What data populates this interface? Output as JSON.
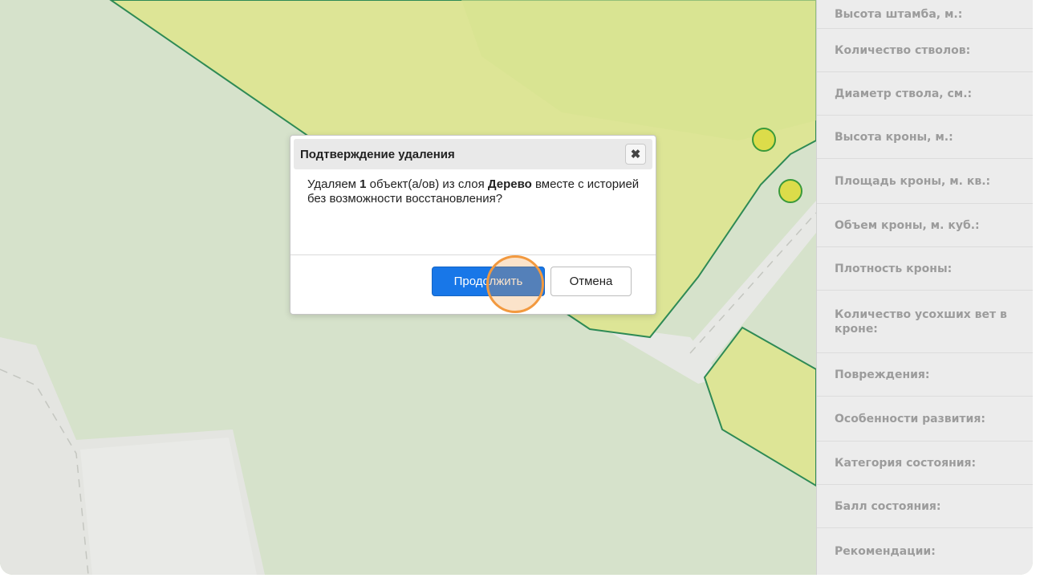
{
  "dialog": {
    "title": "Подтверждение удаления",
    "close_icon": "close-x-icon",
    "message_prefix": "Удаляем ",
    "count": "1",
    "message_middle": " объект(а/ов) из слоя ",
    "layer": "Дерево",
    "message_suffix": " вместе с историей без возможности восстановления?",
    "continue_label": "Продолжить",
    "cancel_label": "Отмена"
  },
  "panel": {
    "fields": [
      "Высота штамба, м.:",
      "Количество стволов:",
      "Диаметр ствола, см.:",
      "Высота кроны, м.:",
      "Площадь кроны, м. кв.:",
      "Объем кроны, м. куб.:",
      "Плотность кроны:",
      "Количество усохших вет в кроне:",
      "Повреждения:",
      "Особенности развития:",
      "Категория состояния:",
      "Балл состояния:",
      "Рекомендации:"
    ]
  },
  "colors": {
    "map_background": "#d6e2cb",
    "polygon_fill": "#dde596",
    "polygon_outline": "#2e8a55",
    "road": "#e7e8e5",
    "tree_marker": "#dcdc4a",
    "primary_button": "#1877e8",
    "click_indicator": "#f2993f"
  }
}
